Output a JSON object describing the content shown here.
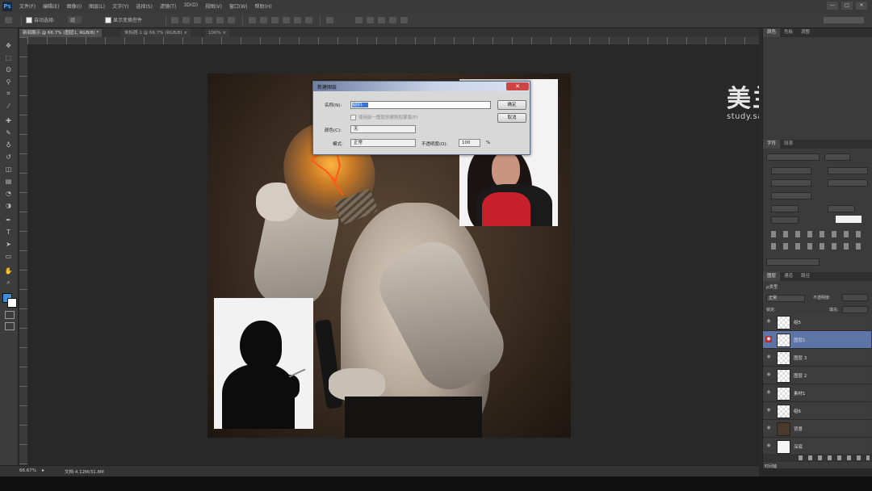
{
  "app": {
    "logo": "Ps",
    "menus": [
      "文件(F)",
      "编辑(E)",
      "图像(I)",
      "图层(L)",
      "文字(Y)",
      "选择(S)",
      "滤镜(T)",
      "3D(D)",
      "视图(V)",
      "窗口(W)",
      "帮助(H)"
    ],
    "window_buttons": [
      "—",
      "□",
      "✕"
    ]
  },
  "options_bar": {
    "auto_select_label": "自动选择:",
    "auto_select_value": "组",
    "show_transform_label": "显示变换控件"
  },
  "doc_tabs": [
    {
      "label": "新闻展示 @ 66.7% (图层1, RGB/8) *",
      "active": true
    },
    {
      "label": "未标题-1 @ 66.7% (RGB/8) ×",
      "active": false
    },
    {
      "label": "100% ×",
      "active": false
    }
  ],
  "tools": [
    "move-tool",
    "marquee-tool",
    "lasso-tool",
    "quick-select-tool",
    "crop-tool",
    "eyedropper-tool",
    "healing-tool",
    "brush-tool",
    "stamp-tool",
    "history-brush-tool",
    "eraser-tool",
    "gradient-tool",
    "blur-tool",
    "dodge-tool",
    "pen-tool",
    "type-tool",
    "path-select-tool",
    "shape-tool",
    "hand-tool",
    "zoom-tool"
  ],
  "tool_glyphs": [
    "✥",
    "⬚",
    "ʘ",
    "⚲",
    "⌗",
    "⁄",
    "✚",
    "✎",
    "♁",
    "↺",
    "◫",
    "▤",
    "◔",
    "◑",
    "✒",
    "T",
    "➤",
    "▭",
    "✋",
    "⌕"
  ],
  "watermark": {
    "title": "美兰学院",
    "url": "study.sanyuemeilan.com"
  },
  "dialog": {
    "title": "新建图层",
    "name_label": "名称(N):",
    "name_value": "图层1",
    "clip_label": "使用前一图层创建剪贴蒙版(P)",
    "color_label": "颜色(C):",
    "color_value": "无",
    "mode_label": "模式:",
    "mode_value": "正常",
    "opacity_label": "不透明度(O):",
    "opacity_value": "100",
    "opacity_unit": "%",
    "ok": "确定",
    "cancel": "取消",
    "close": "✕"
  },
  "panel": {
    "top_tabs": [
      "颜色",
      "色板",
      "调整"
    ],
    "char_tabs": [
      "字符",
      "段落"
    ],
    "layers_tabs": [
      "图层",
      "通道",
      "路径"
    ],
    "kind_label": "ρ类型",
    "blend_mode": "正常",
    "opacity_label": "不透明度:",
    "lock_label": "锁定:",
    "fill_label": "填充:",
    "layers": [
      {
        "name": "组5",
        "selected": false
      },
      {
        "name": "图层1",
        "selected": true
      },
      {
        "name": "图层 3",
        "selected": false
      },
      {
        "name": "图层 2",
        "selected": false
      },
      {
        "name": "素材1",
        "selected": false
      },
      {
        "name": "组6",
        "selected": false
      },
      {
        "name": "背景",
        "selected": false
      },
      {
        "name": "深底",
        "selected": false
      }
    ],
    "footer_label": "时间轴"
  },
  "status": {
    "zoom": "66.67%",
    "doc_info": "文档:4.12M/31.8M"
  },
  "colors": {
    "selected_layer": "#5c74a6",
    "eye_highlight": "#b03030",
    "dialog_selection": "#3874d8"
  }
}
